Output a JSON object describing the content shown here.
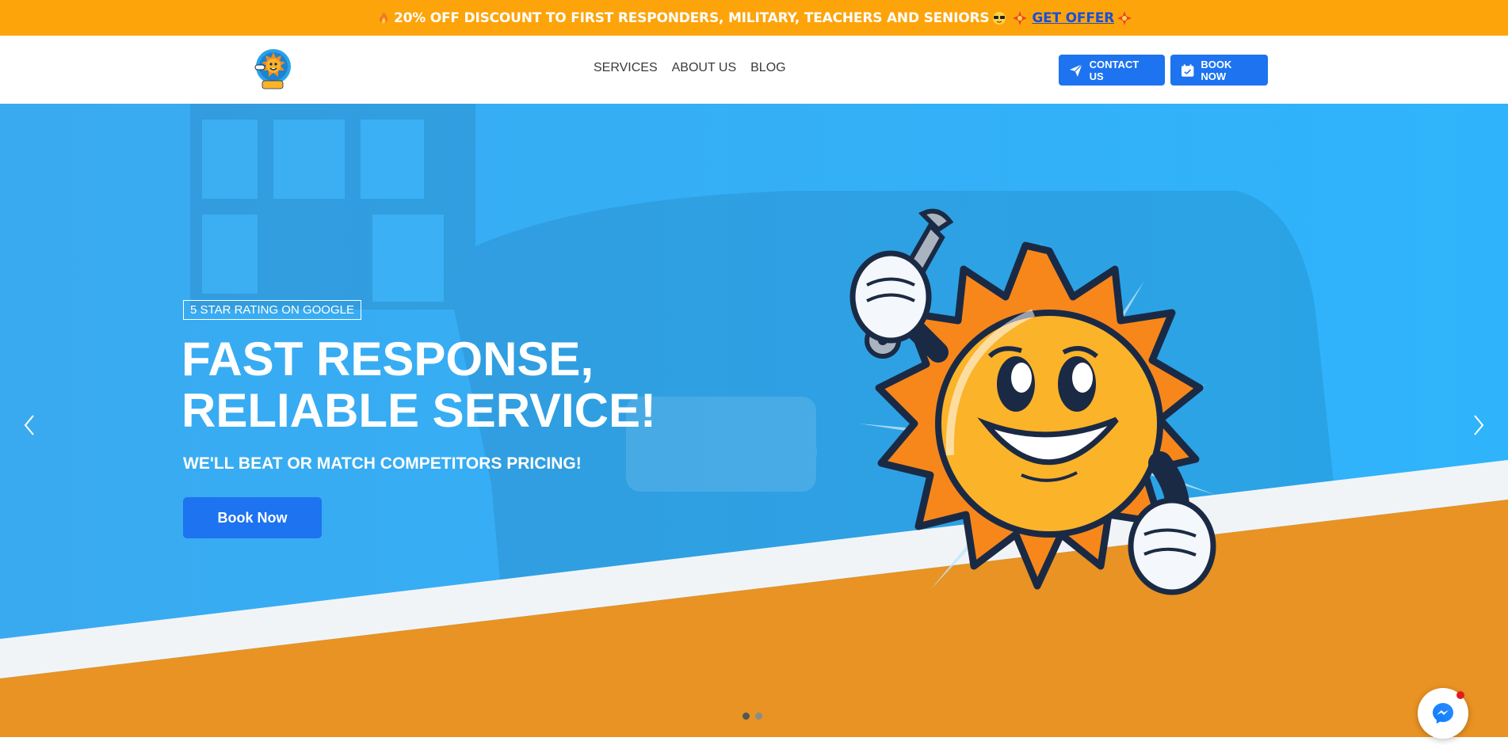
{
  "promo": {
    "text": "20% OFF DISCOUNT TO FIRST RESPONDERS, MILITARY, TEACHERS AND SENIORS",
    "offer_link": "GET OFFER",
    "icons": [
      "fire-emoji",
      "sunglasses-emoji",
      "sparkle-emoji"
    ]
  },
  "header": {
    "logo_icon": "sun-mascot-logo",
    "nav": [
      {
        "label": "SERVICES"
      },
      {
        "label": "ABOUT US"
      },
      {
        "label": "BLOG"
      }
    ],
    "contact_label": "CONTACT US",
    "book_label": "BOOK NOW"
  },
  "hero": {
    "badge": "5 STAR RATING ON GOOGLE",
    "headline_line1": "FAST RESPONSE,",
    "headline_line2": "RELIABLE SERVICE!",
    "subheadline": "WE'LL BEAT OR MATCH COMPETITORS PRICING!",
    "cta_label": "Book Now",
    "slides_total": 2,
    "active_slide": 1
  },
  "colors": {
    "promo_bg": "#fda40b",
    "primary_blue": "#1d73f0",
    "hero_blue": "#36b0f5",
    "hero_orange": "#f39a22",
    "link_blue": "#1a4fd6"
  },
  "chat": {
    "icon": "messenger-icon"
  }
}
